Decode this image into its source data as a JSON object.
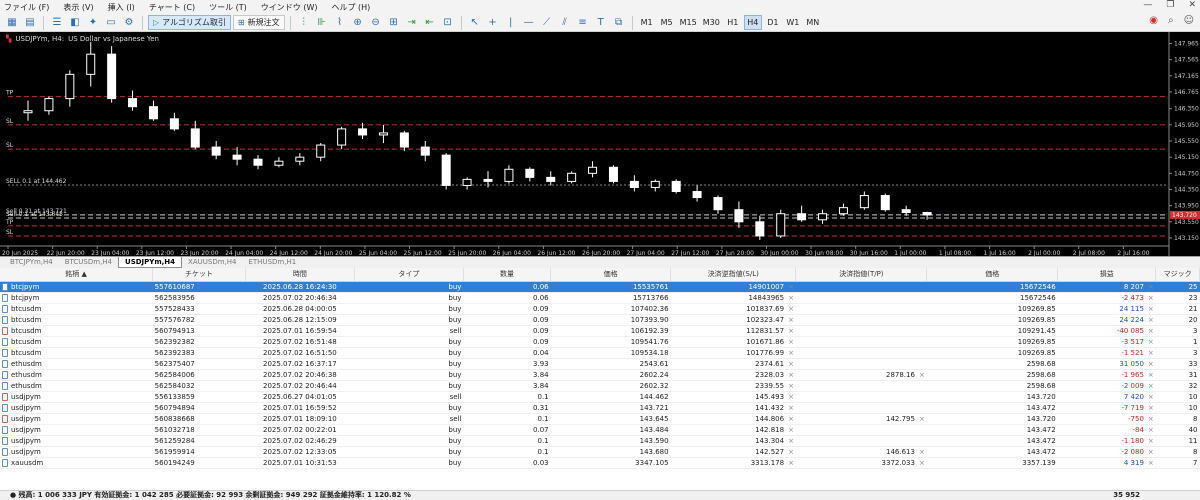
{
  "menu": [
    "ファイル (F)",
    "表示 (V)",
    "挿入 (I)",
    "チャート (C)",
    "ツール (T)",
    "ウインドウ (W)",
    "ヘルプ (H)"
  ],
  "toolbar": {
    "algo_label": "アルゴリズム取引",
    "neworder_label": "新規注文",
    "timeframes": [
      "M1",
      "M5",
      "M15",
      "M30",
      "H1",
      "H4",
      "D1",
      "W1",
      "MN"
    ],
    "active_tf": "H4"
  },
  "chart": {
    "symbol": "USDJPYm, H4:",
    "description": "US Dollar vs Japanese Yen",
    "line_labels": [
      "TP",
      "SL",
      "SL",
      "SELL 0.1 at 144.462",
      "Sell 0.31 at 143.721",
      "Sell 0.1 at 143.645",
      "TP",
      "SL"
    ],
    "price_ticks": [
      "147.965",
      "147.565",
      "147.165",
      "146.765",
      "146.350",
      "145.950",
      "145.550",
      "145.150",
      "144.750",
      "144.350",
      "143.950",
      "143.550",
      "143.150"
    ],
    "current_price": "143.720",
    "current_price_color": "#d03030",
    "time_ticks": [
      "20 Jun 2025",
      "22 Jun 20:00",
      "23 Jun 04:00",
      "23 Jun 12:00",
      "23 Jun 20:00",
      "24 Jun 04:00",
      "24 Jun 12:00",
      "24 Jun 20:00",
      "25 Jun 04:00",
      "25 Jun 12:00",
      "25 Jun 20:00",
      "26 Jun 04:00",
      "26 Jun 12:00",
      "26 Jun 20:00",
      "27 Jun 04:00",
      "27 Jun 12:00",
      "27 Jun 20:00",
      "30 Jun 00:00",
      "30 Jun 08:00",
      "30 Jun 16:00",
      "1 Jul 00:00",
      "1 Jul 08:00",
      "1 Jul 16:00",
      "2 Jul 00:00",
      "2 Jul 08:00",
      "2 Jul 16:00"
    ]
  },
  "chart_data": {
    "type": "candlestick",
    "title": "USDJPYm, H4: US Dollar vs Japanese Yen",
    "ylim": [
      143.05,
      148.1
    ],
    "candles": [
      [
        146.25,
        146.55,
        146.05,
        146.3
      ],
      [
        146.3,
        146.65,
        146.2,
        146.6
      ],
      [
        146.6,
        147.3,
        146.4,
        147.2
      ],
      [
        147.2,
        148.0,
        146.9,
        147.7
      ],
      [
        147.7,
        147.9,
        146.5,
        146.6
      ],
      [
        146.6,
        146.8,
        146.3,
        146.4
      ],
      [
        146.4,
        146.55,
        146.05,
        146.1
      ],
      [
        146.1,
        146.25,
        145.8,
        145.85
      ],
      [
        145.85,
        146.05,
        145.35,
        145.4
      ],
      [
        145.4,
        145.55,
        145.1,
        145.2
      ],
      [
        145.2,
        145.4,
        144.95,
        145.1
      ],
      [
        145.1,
        145.2,
        144.85,
        144.95
      ],
      [
        144.95,
        145.15,
        144.9,
        145.05
      ],
      [
        145.05,
        145.25,
        144.95,
        145.15
      ],
      [
        145.15,
        145.5,
        145.05,
        145.45
      ],
      [
        145.45,
        145.9,
        145.35,
        145.85
      ],
      [
        145.85,
        146.0,
        145.6,
        145.7
      ],
      [
        145.7,
        145.95,
        145.5,
        145.75
      ],
      [
        145.75,
        145.8,
        145.3,
        145.4
      ],
      [
        145.4,
        145.55,
        145.05,
        145.2
      ],
      [
        145.2,
        145.25,
        144.35,
        144.45
      ],
      [
        144.45,
        144.65,
        144.35,
        144.6
      ],
      [
        144.6,
        144.8,
        144.4,
        144.55
      ],
      [
        144.55,
        144.95,
        144.5,
        144.85
      ],
      [
        144.85,
        144.9,
        144.55,
        144.65
      ],
      [
        144.65,
        144.8,
        144.45,
        144.55
      ],
      [
        144.55,
        144.8,
        144.5,
        144.75
      ],
      [
        144.75,
        145.05,
        144.65,
        144.9
      ],
      [
        144.9,
        144.95,
        144.5,
        144.55
      ],
      [
        144.55,
        144.7,
        144.3,
        144.4
      ],
      [
        144.4,
        144.6,
        144.3,
        144.55
      ],
      [
        144.55,
        144.6,
        144.25,
        144.3
      ],
      [
        144.3,
        144.45,
        144.05,
        144.15
      ],
      [
        144.15,
        144.2,
        143.75,
        143.85
      ],
      [
        143.85,
        144.05,
        143.4,
        143.55
      ],
      [
        143.55,
        143.7,
        143.1,
        143.2
      ],
      [
        143.2,
        143.85,
        143.15,
        143.75
      ],
      [
        143.75,
        143.95,
        143.55,
        143.6
      ],
      [
        143.6,
        143.85,
        143.5,
        143.75
      ],
      [
        143.75,
        144.0,
        143.7,
        143.9
      ],
      [
        143.9,
        144.3,
        143.85,
        144.2
      ],
      [
        144.2,
        144.25,
        143.8,
        143.85
      ],
      [
        143.85,
        143.95,
        143.7,
        143.78
      ],
      [
        143.78,
        143.8,
        143.6,
        143.72
      ]
    ],
    "horizontal_lines": [
      146.65,
      145.95,
      145.35,
      144.46,
      143.72,
      143.645,
      143.45,
      143.2
    ]
  },
  "tabs": [
    "BTCJPYm,H4",
    "BTCUSDm,H4",
    "USDJPYm,H4",
    "XAUUSDm,H4",
    "ETHUSDm,H1"
  ],
  "active_tab": "USDJPYm,H4",
  "table": {
    "headers": [
      "銘柄",
      "チケット",
      "時間",
      "タイプ",
      "数量",
      "価格",
      "決済逆指値(S/L)",
      "決済指値(T/P)",
      "価格",
      "損益",
      "マジック"
    ],
    "rows": [
      [
        "btcjpym",
        "557610687",
        "2025.06.28 16:24:30",
        "buy",
        "0.06",
        "15535761",
        "14901007",
        "",
        "15672546",
        "8 207",
        "25"
      ],
      [
        "btcjpym",
        "562583956",
        "2025.07.02 20:46:34",
        "buy",
        "0.06",
        "15713766",
        "14843965",
        "",
        "15672546",
        "-2 473",
        "23"
      ],
      [
        "btcusdm",
        "557528433",
        "2025.06.28 04:00:05",
        "buy",
        "0.09",
        "107402.36",
        "101837.69",
        "",
        "109269.85",
        "24 115",
        "21"
      ],
      [
        "btcusdm",
        "557576782",
        "2025.06.28 12:15:09",
        "buy",
        "0.09",
        "107393.90",
        "102323.47",
        "",
        "109269.85",
        "24 224",
        "20"
      ],
      [
        "btcusdm",
        "560794913",
        "2025.07.01 16:59:54",
        "sell",
        "0.09",
        "106192.39",
        "112831.57",
        "",
        "109291.45",
        "-40 085",
        "3"
      ],
      [
        "btcusdm",
        "562392382",
        "2025.07.02 16:51:48",
        "buy",
        "0.09",
        "109541.76",
        "101671.86",
        "",
        "109269.85",
        "-3 517",
        "1"
      ],
      [
        "btcusdm",
        "562392383",
        "2025.07.02 16:51:50",
        "buy",
        "0.04",
        "109534.18",
        "101776.99",
        "",
        "109269.85",
        "-1 521",
        "3"
      ],
      [
        "ethusdm",
        "562375407",
        "2025.07.02 16:37:17",
        "buy",
        "3.93",
        "2543.61",
        "2374.61",
        "",
        "2598.68",
        "31 050",
        "33"
      ],
      [
        "ethusdm",
        "562584006",
        "2025.07.02 20:46:38",
        "buy",
        "3.84",
        "2602.24",
        "2328.03",
        "2878.16",
        "2598.68",
        "-1 965",
        "31"
      ],
      [
        "ethusdm",
        "562584032",
        "2025.07.02 20:46:44",
        "buy",
        "3.84",
        "2602.32",
        "2339.55",
        "",
        "2598.68",
        "-2 009",
        "32"
      ],
      [
        "usdjpym",
        "556133859",
        "2025.06.27 04:01:05",
        "sell",
        "0.1",
        "144.462",
        "145.493",
        "",
        "143.720",
        "7 420",
        "10"
      ],
      [
        "usdjpym",
        "560794894",
        "2025.07.01 16:59:52",
        "buy",
        "0.31",
        "143.721",
        "141.432",
        "",
        "143.472",
        "-7 719",
        "10"
      ],
      [
        "usdjpym",
        "560838668",
        "2025.07.01 18:09:10",
        "sell",
        "0.1",
        "143.645",
        "144.806",
        "142.795",
        "143.720",
        "-750",
        "8"
      ],
      [
        "usdjpym",
        "561032718",
        "2025.07.02 00:22:01",
        "buy",
        "0.07",
        "143.484",
        "142.818",
        "",
        "143.472",
        "-84",
        "40"
      ],
      [
        "usdjpym",
        "561259284",
        "2025.07.02 02:46:29",
        "buy",
        "0.1",
        "143.590",
        "143.304",
        "",
        "143.472",
        "-1 180",
        "11"
      ],
      [
        "usdjpym",
        "561959914",
        "2025.07.02 12:33:05",
        "buy",
        "0.1",
        "143.680",
        "142.527",
        "146.613",
        "143.472",
        "-2 080",
        "8"
      ],
      [
        "xauusdm",
        "560194249",
        "2025.07.01 10:31:53",
        "buy",
        "0.03",
        "3347.105",
        "3313.178",
        "3372.033",
        "3357.139",
        "4 319",
        "7"
      ]
    ]
  },
  "status": {
    "text": "残高: 1 006 333 JPY  有効証拠金: 1 042 285  必要証拠金: 92 993  余剰証拠金: 949 292  証拠金維持率: 1 120.82 %",
    "total": "35 952"
  }
}
